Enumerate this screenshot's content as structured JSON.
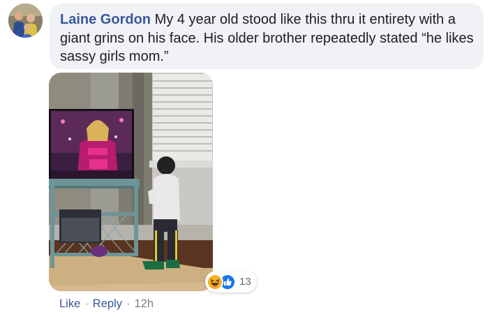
{
  "comment": {
    "author": "Laine Gordon",
    "text": "My 4 year old stood like this thru it entirety with a giant grins on his face. His older brother repeatedly stated “he likes sassy girls mom.”"
  },
  "reactions": {
    "icons": [
      "haha-icon",
      "like-icon"
    ],
    "count": "13",
    "colors": {
      "haha": "#f7b125",
      "like": "#1877f2"
    }
  },
  "actions": {
    "like_label": "Like",
    "separator": "·",
    "reply_label": "Reply",
    "timestamp": "12h"
  },
  "colors": {
    "bubble_bg": "#f0f2f5",
    "author": "#385898",
    "text": "#1c1e21",
    "meta": "#7c8087"
  }
}
